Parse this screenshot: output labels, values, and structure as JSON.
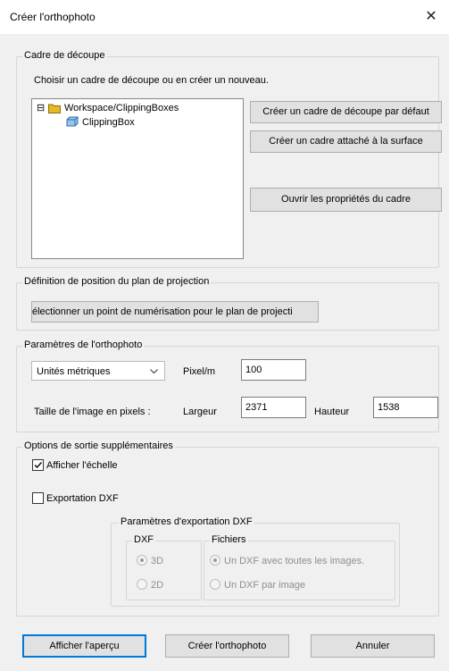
{
  "window": {
    "title": "Créer l'orthophoto",
    "close_glyph": "✕"
  },
  "clipping": {
    "legend": "Cadre de découpe",
    "instruction": "Choisir un cadre de découpe ou en créer un nouveau.",
    "tree": {
      "expander": "⊟",
      "root": "Workspace/ClippingBoxes",
      "child": "ClippingBox"
    },
    "btn_default": "Créer un cadre de découpe par défaut",
    "btn_surface": "Créer un cadre attaché à la surface",
    "btn_properties": "Ouvrir les propriétés du cadre"
  },
  "projection": {
    "legend": "Définition de position du plan de projection",
    "btn_select": "électionner un point de numérisation pour le plan de projecti"
  },
  "params": {
    "legend": "Paramètres de l'orthophoto",
    "units_selected": "Unités métriques",
    "pixel_label": "Pixel/m",
    "pixel_value": "100",
    "size_label": "Taille de l'image en pixels :",
    "width_label": "Largeur",
    "width_value": "2371",
    "height_label": "Hauteur",
    "height_value": "1538"
  },
  "output": {
    "legend": "Options de sortie supplémentaires",
    "show_scale_label": "Afficher l'échelle",
    "show_scale_checked": true,
    "dxf_export_label": "Exportation DXF",
    "dxf_export_checked": false,
    "dxf_params": {
      "legend": "Paramètres d'exportation DXF",
      "dxf_group": "DXF",
      "opt_3d": "3D",
      "opt_2d": "2D",
      "files_group": "Fichiers",
      "opt_all": "Un DXF avec toutes les images.",
      "opt_each": "Un DXF par image"
    }
  },
  "footer": {
    "preview": "Afficher l'aperçu",
    "create": "Créer l'orthophoto",
    "cancel": "Annuler"
  },
  "colors": {
    "folder": "#e8b923",
    "box": "#3c7fc9",
    "accent_border": "#0078d7"
  }
}
